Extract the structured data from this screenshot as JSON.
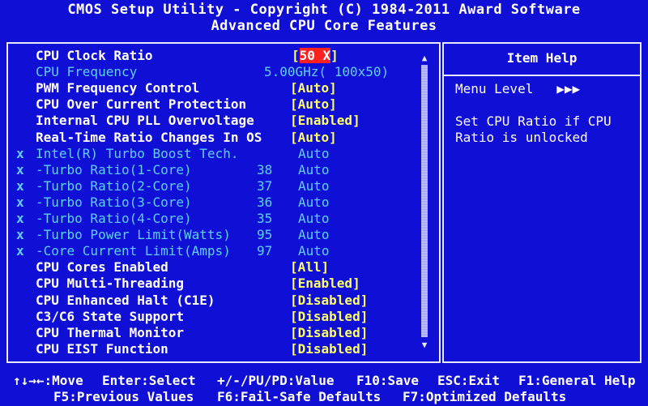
{
  "header": {
    "title": "CMOS Setup Utility - Copyright (C) 1984-2011 Award Software",
    "subtitle": "Advanced CPU Core Features"
  },
  "rows": [
    {
      "mark": "",
      "label": "CPU Clock Ratio",
      "num": "",
      "value": "[50 X]",
      "value_prefix": "[",
      "value_hl": "50 X",
      "value_suffix": "]",
      "style": "selected"
    },
    {
      "mark": "",
      "label": "CPU Frequency",
      "num": "",
      "value": "5.00GHz( 100x50)",
      "style": "info"
    },
    {
      "mark": "",
      "label": "PWM Frequency Control",
      "num": "",
      "value": "[Auto]",
      "style": "normal"
    },
    {
      "mark": "",
      "label": "CPU Over Current Protection",
      "num": "",
      "value": "[Auto]",
      "style": "normal"
    },
    {
      "mark": "",
      "label": "Internal CPU PLL Overvoltage",
      "num": "",
      "value": "[Enabled]",
      "style": "normal"
    },
    {
      "mark": "",
      "label": "Real-Time Ratio Changes In OS",
      "num": "",
      "value": "[Auto]",
      "style": "normal"
    },
    {
      "mark": "x",
      "label": "Intel(R) Turbo Boost Tech.",
      "num": "",
      "value": "Auto",
      "style": "locked"
    },
    {
      "mark": "x",
      "label": "-Turbo Ratio(1-Core)",
      "num": "38",
      "value": "Auto",
      "style": "locked"
    },
    {
      "mark": "x",
      "label": "-Turbo Ratio(2-Core)",
      "num": "37",
      "value": "Auto",
      "style": "locked"
    },
    {
      "mark": "x",
      "label": "-Turbo Ratio(3-Core)",
      "num": "36",
      "value": "Auto",
      "style": "locked"
    },
    {
      "mark": "x",
      "label": "-Turbo Ratio(4-Core)",
      "num": "35",
      "value": "Auto",
      "style": "locked"
    },
    {
      "mark": "x",
      "label": "-Turbo Power Limit(Watts)",
      "num": "95",
      "value": "Auto",
      "style": "locked"
    },
    {
      "mark": "x",
      "label": "-Core Current Limit(Amps)",
      "num": "97",
      "value": "Auto",
      "style": "locked"
    },
    {
      "mark": "",
      "label": "CPU Cores Enabled",
      "num": "",
      "value": "[All]",
      "style": "normal"
    },
    {
      "mark": "",
      "label": "CPU Multi-Threading",
      "num": "",
      "value": "[Enabled]",
      "style": "normal"
    },
    {
      "mark": "",
      "label": "CPU Enhanced Halt (C1E)",
      "num": "",
      "value": "[Disabled]",
      "style": "normal"
    },
    {
      "mark": "",
      "label": "C3/C6 State Support",
      "num": "",
      "value": "[Disabled]",
      "style": "normal"
    },
    {
      "mark": "",
      "label": "CPU Thermal Monitor",
      "num": "",
      "value": "[Disabled]",
      "style": "normal"
    },
    {
      "mark": "",
      "label": "CPU EIST Function",
      "num": "",
      "value": "[Disabled]",
      "style": "normal"
    }
  ],
  "scroll": {
    "up": "▲",
    "down": "▼"
  },
  "help": {
    "title": "Item Help",
    "menu_level": "Menu Level   ▶▶▶",
    "lines": [
      "Set CPU Ratio if CPU",
      "Ratio is unlocked"
    ]
  },
  "footer": {
    "line1": [
      {
        "key": "↑↓→←:Move"
      },
      {
        "key": "Enter:Select"
      },
      {
        "key": "+/-/PU/PD:Value"
      },
      {
        "key": "F10:Save"
      },
      {
        "key": "ESC:Exit"
      },
      {
        "key": "F1:General Help"
      }
    ],
    "line2": [
      {
        "key": "F5:Previous Values"
      },
      {
        "key": "F6:Fail-Safe Defaults"
      },
      {
        "key": "F7:Optimized Defaults"
      }
    ]
  },
  "colors": {
    "background": "#0f0fd6",
    "label": "#ffffff",
    "value": "#ffff66",
    "disabled": "#5fd0ff",
    "selection": "#ff2020"
  }
}
